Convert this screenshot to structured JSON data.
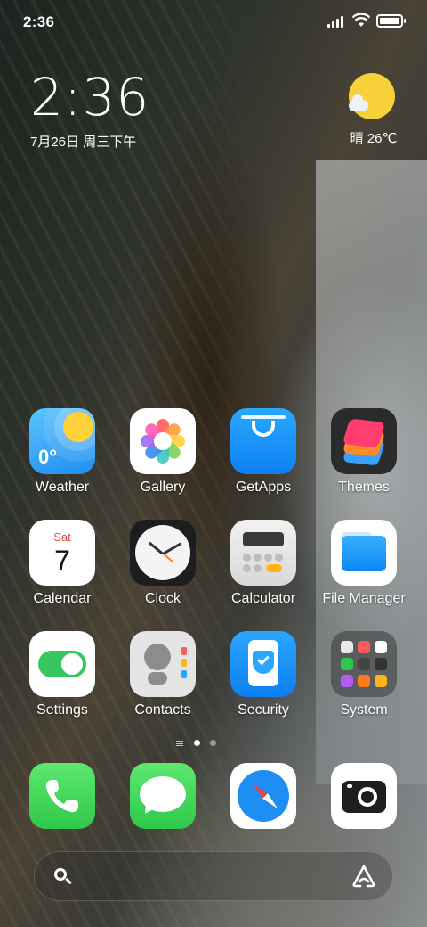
{
  "status_bar": {
    "time": "2:36",
    "icons": [
      "signal-icon",
      "wifi-icon",
      "battery-icon"
    ],
    "battery_level": 1.0
  },
  "clock_widget": {
    "time": "2:36",
    "date": "7月26日 周三下午"
  },
  "weather_widget": {
    "text": "晴 26℃",
    "icon": "sunny-cloud-icon"
  },
  "apps": [
    {
      "label": "Weather",
      "icon": "weather-icon",
      "badge": "0°"
    },
    {
      "label": "Gallery",
      "icon": "gallery-icon"
    },
    {
      "label": "GetApps",
      "icon": "getapps-icon"
    },
    {
      "label": "Themes",
      "icon": "themes-icon"
    },
    {
      "label": "Calendar",
      "icon": "calendar-icon",
      "day": "Sat",
      "date": "7"
    },
    {
      "label": "Clock",
      "icon": "clock-icon"
    },
    {
      "label": "Calculator",
      "icon": "calculator-icon"
    },
    {
      "label": "File Manager",
      "icon": "file-manager-icon"
    },
    {
      "label": "Settings",
      "icon": "settings-icon"
    },
    {
      "label": "Contacts",
      "icon": "contacts-icon"
    },
    {
      "label": "Security",
      "icon": "security-icon"
    },
    {
      "label": "System",
      "icon": "system-folder-icon"
    }
  ],
  "page_indicator": {
    "pages": 2,
    "current": 1
  },
  "dock": [
    {
      "name": "phone",
      "icon": "phone-icon"
    },
    {
      "name": "messages",
      "icon": "messages-icon"
    },
    {
      "name": "browser",
      "icon": "browser-icon"
    },
    {
      "name": "camera",
      "icon": "camera-icon"
    }
  ],
  "search_bar": {
    "search_icon": "search-icon",
    "assistant_icon": "assistant-icon"
  },
  "colors": {
    "accent_blue": "#1f8ef0",
    "green": "#37c660",
    "sun_yellow": "#f6d13a"
  }
}
